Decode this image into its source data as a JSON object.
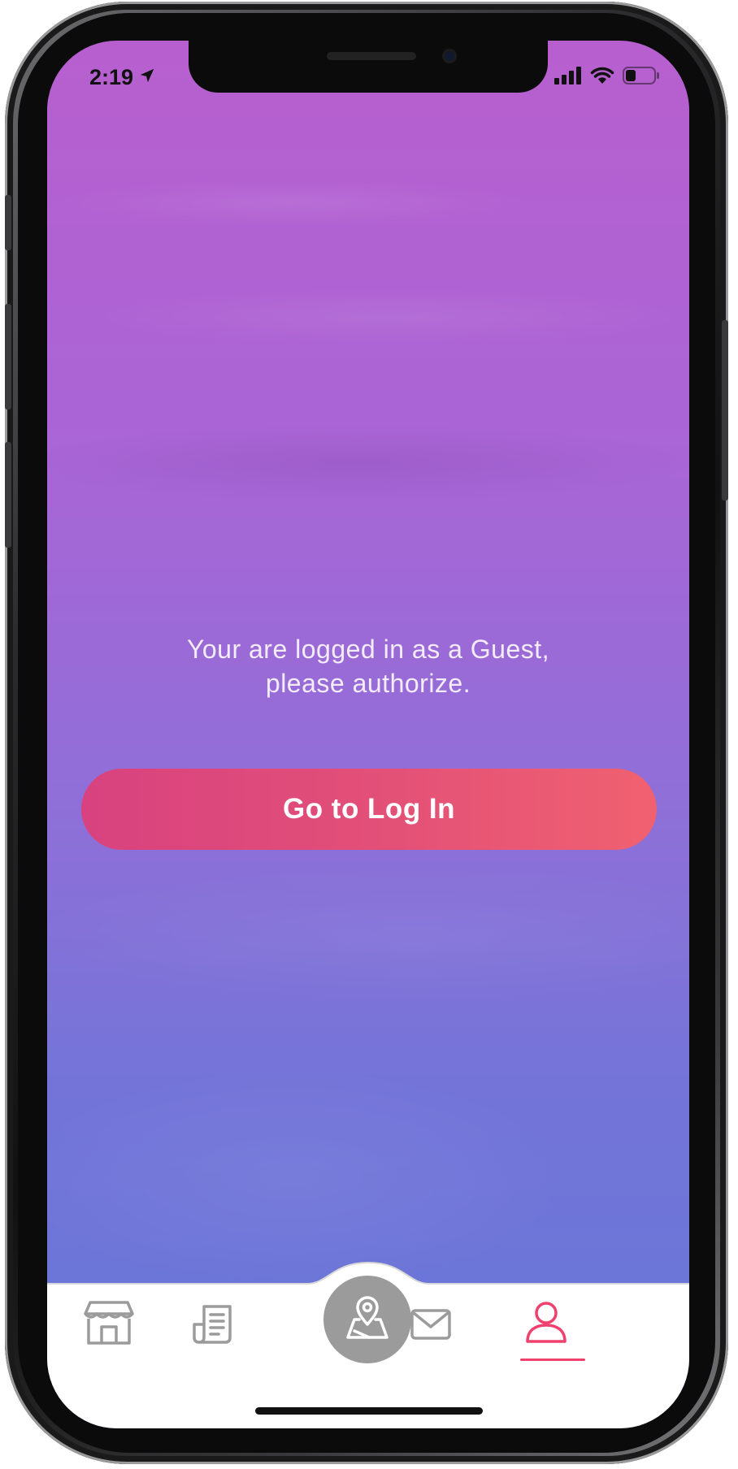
{
  "status_bar": {
    "time": "2:19"
  },
  "main": {
    "message_line1": "Your are logged in as a Guest,",
    "message_line2": "please authorize.",
    "login_button_label": "Go to Log In"
  },
  "tab_bar": {
    "items": [
      {
        "icon": "store-icon",
        "active": false
      },
      {
        "icon": "news-icon",
        "active": false
      },
      {
        "icon": "map-pin-icon",
        "active": false,
        "center": true
      },
      {
        "icon": "mail-icon",
        "active": false
      },
      {
        "icon": "user-icon",
        "active": true
      }
    ]
  },
  "colors": {
    "accent": "#f0406d",
    "button_start": "#d8427f",
    "button_end": "#f06170",
    "inactive_icon": "#9b9b9b",
    "background_top": "#b85fcf",
    "background_bottom": "#6677d8"
  }
}
